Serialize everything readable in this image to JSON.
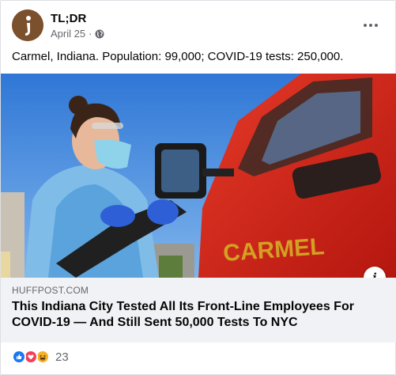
{
  "post": {
    "author": "TL;DR",
    "date": "April 25",
    "separator": "·",
    "audience_icon": "globe-icon",
    "more_icon": "more-horizontal-icon",
    "text": "Carmel, Indiana. Population: 99,000; COVID-19 tests: 250,000."
  },
  "link": {
    "domain": "HUFFPOST.COM",
    "title": "This Indiana City Tested All Its Front-Line Employees For COVID-19 — And Still Sent 50,000 Tests To NYC",
    "image_truck_lettering": "CARMEL",
    "info_label": "i"
  },
  "reactions": {
    "types": [
      "like-icon",
      "love-icon",
      "haha-icon"
    ],
    "count": "23"
  },
  "colors": {
    "like": "#1877f2",
    "love": "#f33e58",
    "haha": "#f7b125",
    "caption_bg": "#f0f2f5",
    "secondary_text": "#65676b"
  }
}
